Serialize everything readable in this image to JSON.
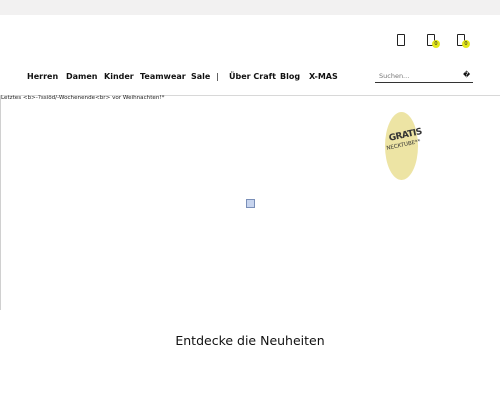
{
  "header": {
    "icons": [
      {
        "name": "account-icon",
        "badge": null
      },
      {
        "name": "wishlist-icon",
        "badge": "0"
      },
      {
        "name": "cart-icon",
        "badge": "0"
      }
    ],
    "badge_color": "#e3e81a"
  },
  "nav": {
    "items": [
      "Herren",
      "Damen",
      "Kinder",
      "Teamwear",
      "Sale"
    ],
    "separator": "|",
    "items_after": [
      "Über Craft",
      "Blog",
      "X-MAS"
    ]
  },
  "search": {
    "placeholder": "Suchen...",
    "button_glyph": "�"
  },
  "hero": {
    "countdown_text": "Letztes <b>-?ssiöd/-Wochenende<br> vor Weihnachten!*",
    "promo": {
      "line1": "GRATIS",
      "line2": "NECKTUBE**",
      "color": "#ede4a4"
    },
    "loader": "loading-icon"
  },
  "section": {
    "title": "Entdecke die Neuheiten"
  }
}
